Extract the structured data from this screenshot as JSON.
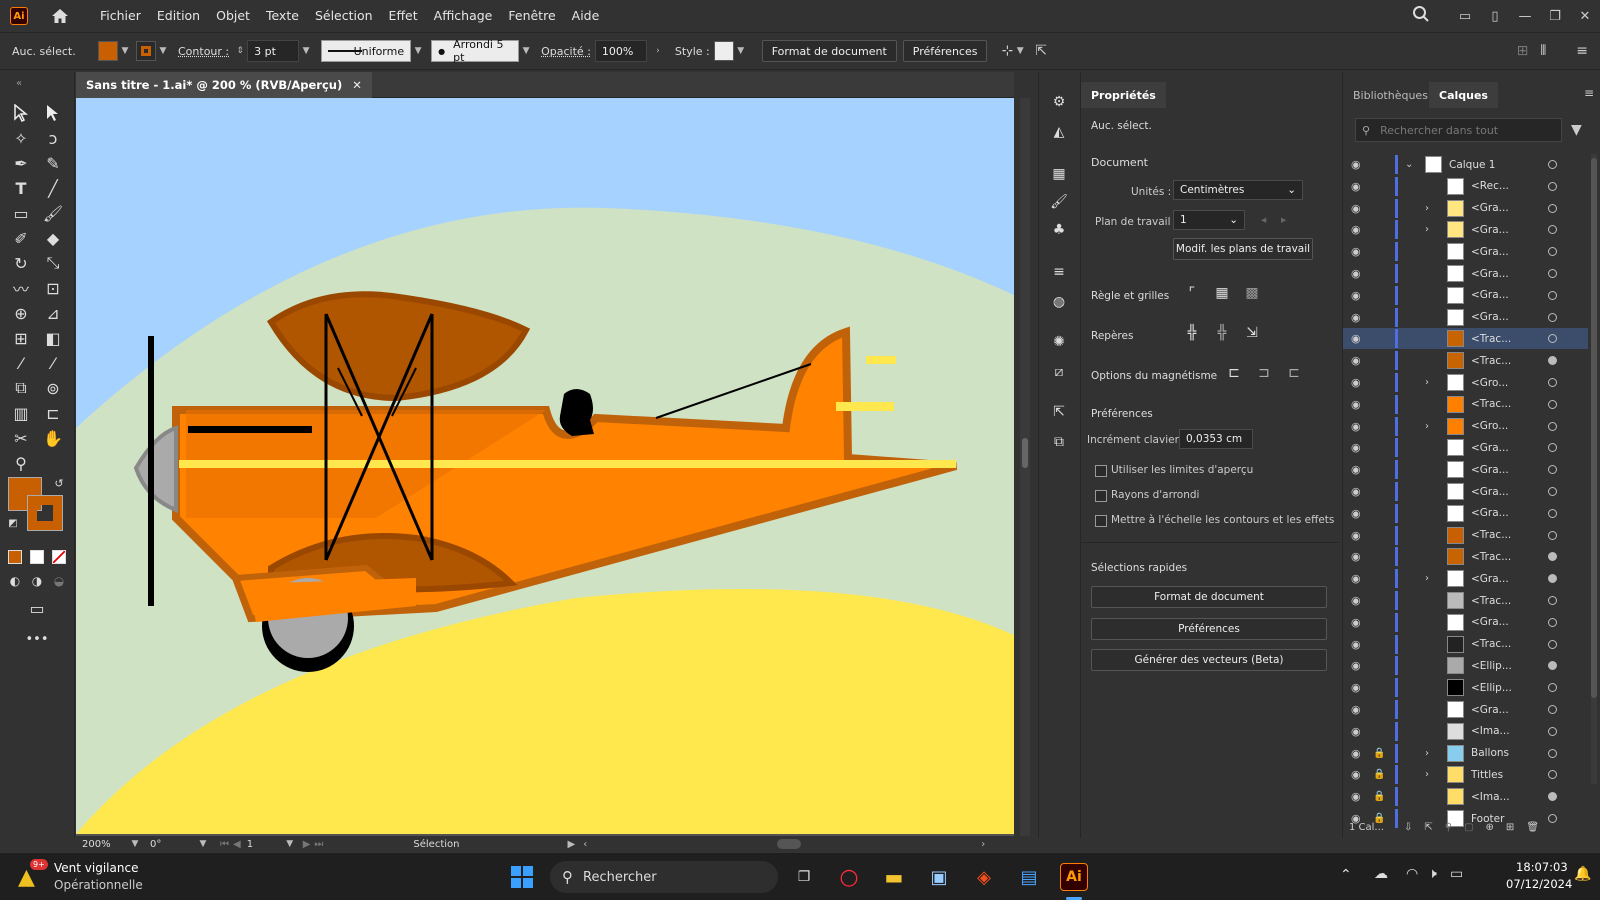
{
  "menubar": {
    "logo": "Ai",
    "items": [
      "Fichier",
      "Edition",
      "Objet",
      "Texte",
      "Sélection",
      "Effet",
      "Affichage",
      "Fenêtre",
      "Aide"
    ]
  },
  "controlbar": {
    "no_selection": "Auc. sélect.",
    "fill_color": "#c85f00",
    "stroke_color": "#c85f00",
    "contour_label": "Contour :",
    "stroke_weight": "3 pt",
    "stroke_style": "Uniforme",
    "brush": "Arrondi 5 pt",
    "opacity_label": "Opacité :",
    "opacity": "100%",
    "style_label": "Style :",
    "doc_format_btn": "Format de document",
    "prefs_btn": "Préférences"
  },
  "document": {
    "tab_title": "Sans titre - 1.ai* @ 200 % (RVB/Aperçu)",
    "close": "✕"
  },
  "statusbar": {
    "zoom": "200%",
    "rotation": "0°",
    "artboard": "1",
    "tool": "Sélection"
  },
  "properties": {
    "tab": "Propriétés",
    "no_selection": "Auc. sélect.",
    "document_section": "Document",
    "units_label": "Unités :",
    "units_value": "Centimètres",
    "artboard_label": "Plan de travail :",
    "artboard_value": "1",
    "edit_artboards_btn": "Modif. les plans de travail",
    "rulers_label": "Règle et grilles",
    "guides_label": "Repères",
    "snap_label": "Options du magnétisme",
    "prefs_section": "Préférences",
    "key_increment_label": "Incrément clavier :",
    "key_increment_value": "0,0353 cm",
    "cb_preview_bounds": "Utiliser les limites d'aperçu",
    "cb_corner_radius": "Rayons d'arrondi",
    "cb_scale_strokes": "Mettre à l'échelle les contours et les effets",
    "quick_section": "Sélections rapides",
    "quick_btn1": "Format de document",
    "quick_btn2": "Préférences",
    "quick_btn3": "Générer des vecteurs (Beta)"
  },
  "layers": {
    "tab_libraries": "Bibliothèques",
    "tab_layers": "Calques",
    "search_placeholder": "Rechercher dans tout",
    "footer": "1 Cal...",
    "rows": [
      {
        "name": "Calque 1",
        "level": 0,
        "expand": "v",
        "locked": false,
        "thumb": "#ffffff",
        "target": "open",
        "selected": false
      },
      {
        "name": "<Rec...",
        "level": 1,
        "expand": "",
        "locked": false,
        "thumb": "#ffffff",
        "target": "open",
        "selected": false
      },
      {
        "name": "<Gra...",
        "level": 1,
        "expand": ">",
        "locked": false,
        "thumb": "#ffe680",
        "target": "open",
        "selected": false
      },
      {
        "name": "<Gra...",
        "level": 1,
        "expand": ">",
        "locked": false,
        "thumb": "#ffe680",
        "target": "open",
        "selected": false
      },
      {
        "name": "<Gra...",
        "level": 1,
        "expand": "",
        "locked": false,
        "thumb": "#ffffff",
        "target": "open",
        "selected": false
      },
      {
        "name": "<Gra...",
        "level": 1,
        "expand": "",
        "locked": false,
        "thumb": "#ffffff",
        "target": "open",
        "selected": false
      },
      {
        "name": "<Gra...",
        "level": 1,
        "expand": "",
        "locked": false,
        "thumb": "#ffffff",
        "target": "open",
        "selected": false
      },
      {
        "name": "<Gra...",
        "level": 1,
        "expand": "",
        "locked": false,
        "thumb": "#ffffff",
        "target": "open",
        "selected": false
      },
      {
        "name": "<Trac...",
        "level": 1,
        "expand": "",
        "locked": false,
        "thumb": "#c86400",
        "target": "open",
        "selected": true
      },
      {
        "name": "<Trac...",
        "level": 1,
        "expand": "",
        "locked": false,
        "thumb": "#c86400",
        "target": "filled",
        "selected": false
      },
      {
        "name": "<Gro...",
        "level": 1,
        "expand": ">",
        "locked": false,
        "thumb": "#ffffff",
        "target": "open",
        "selected": false
      },
      {
        "name": "<Trac...",
        "level": 1,
        "expand": "",
        "locked": false,
        "thumb": "#ff8000",
        "target": "open",
        "selected": false
      },
      {
        "name": "<Gro...",
        "level": 1,
        "expand": ">",
        "locked": false,
        "thumb": "#ff8000",
        "target": "open",
        "selected": false
      },
      {
        "name": "<Gra...",
        "level": 1,
        "expand": "",
        "locked": false,
        "thumb": "#ffffff",
        "target": "open",
        "selected": false
      },
      {
        "name": "<Gra...",
        "level": 1,
        "expand": "",
        "locked": false,
        "thumb": "#ffffff",
        "target": "open",
        "selected": false
      },
      {
        "name": "<Gra...",
        "level": 1,
        "expand": "",
        "locked": false,
        "thumb": "#ffffff",
        "target": "open",
        "selected": false
      },
      {
        "name": "<Gra...",
        "level": 1,
        "expand": "",
        "locked": false,
        "thumb": "#ffffff",
        "target": "open",
        "selected": false
      },
      {
        "name": "<Trac...",
        "level": 1,
        "expand": "",
        "locked": false,
        "thumb": "#c85f00",
        "target": "open",
        "selected": false
      },
      {
        "name": "<Trac...",
        "level": 1,
        "expand": "",
        "locked": false,
        "thumb": "#c86400",
        "target": "filled",
        "selected": false
      },
      {
        "name": "<Gra...",
        "level": 1,
        "expand": ">",
        "locked": false,
        "thumb": "#ffffff",
        "target": "filled",
        "selected": false
      },
      {
        "name": "<Trac...",
        "level": 1,
        "expand": "",
        "locked": false,
        "thumb": "#bbbbbb",
        "target": "open",
        "selected": false
      },
      {
        "name": "<Gra...",
        "level": 1,
        "expand": "",
        "locked": false,
        "thumb": "#ffffff",
        "target": "open",
        "selected": false
      },
      {
        "name": "<Trac...",
        "level": 1,
        "expand": "",
        "locked": false,
        "thumb": "#222222",
        "target": "open",
        "selected": false
      },
      {
        "name": "<Ellip...",
        "level": 1,
        "expand": "",
        "locked": false,
        "thumb": "#aaaaaa",
        "target": "filled",
        "selected": false
      },
      {
        "name": "<Ellip...",
        "level": 1,
        "expand": "",
        "locked": false,
        "thumb": "#000000",
        "target": "open",
        "selected": false
      },
      {
        "name": "<Gra...",
        "level": 1,
        "expand": "",
        "locked": false,
        "thumb": "#ffffff",
        "target": "open",
        "selected": false
      },
      {
        "name": "<Ima...",
        "level": 1,
        "expand": "",
        "locked": false,
        "thumb": "#dddddd",
        "target": "open",
        "selected": false
      },
      {
        "name": "Ballons",
        "level": 1,
        "expand": ">",
        "locked": true,
        "thumb": "#88ccee",
        "target": "open",
        "selected": false
      },
      {
        "name": "Tittles",
        "level": 1,
        "expand": ">",
        "locked": true,
        "thumb": "#ffdd66",
        "target": "open",
        "selected": false
      },
      {
        "name": "<Ima...",
        "level": 1,
        "expand": "",
        "locked": true,
        "thumb": "#ffdd66",
        "target": "filled",
        "selected": false
      },
      {
        "name": "Footer",
        "level": 1,
        "expand": "",
        "locked": true,
        "thumb": "#ffffff",
        "target": "open",
        "selected": false
      }
    ]
  },
  "taskbar": {
    "weather_badge": "9+",
    "weather_title": "Vent vigilance",
    "weather_sub": "Opérationnelle",
    "search_placeholder": "Rechercher",
    "time": "18:07:03",
    "date": "07/12/2024"
  },
  "colors": {
    "sky": "#a5d2ff",
    "hill": "#cfe2c4",
    "ground": "#ffe84d",
    "plane_body": "#ff8200",
    "plane_dark": "#c85f00",
    "accent": "#4f6fe0"
  }
}
